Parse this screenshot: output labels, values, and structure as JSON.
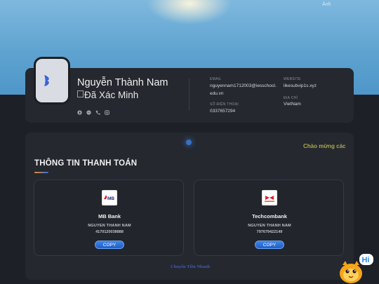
{
  "banner": {
    "image_alt": "Ảnh"
  },
  "profile": {
    "name": "Nguyễn Thành Nam",
    "verified_alt": "Đã Xác Minh",
    "socials": [
      "facebook-icon",
      "messenger-icon",
      "phone-icon",
      "instagram-icon"
    ]
  },
  "contact": {
    "email_label": "EMAIL",
    "email_line1": "nguyennam1712003@iesschool.",
    "email_line2": "edu.vn",
    "phone_label": "SỐ ĐIỆN THOẠI",
    "phone_value": "0337657294",
    "website_label": "WEBSITE",
    "website_value": "likesubvip1s.xyz",
    "address_label": "ĐỊA CHỈ",
    "address_value": "VietNam"
  },
  "greeting": "Chào mừng các",
  "payment": {
    "title": "THÔNG TIN THANH TOÁN",
    "banks": [
      {
        "name": "MB Bank",
        "owner": "NGUYEN THANH NAM",
        "account": "4170120038888",
        "copy_label": "COPY",
        "logo_text": "MB"
      },
      {
        "name": "Techcombank",
        "owner": "NGUYEN THANH NAM",
        "account": "797679422149",
        "copy_label": "COPY",
        "logo_text": "TCB"
      }
    ]
  },
  "footer": {
    "link_text": "Chuyển Tiền Nhanh"
  },
  "mascot": {
    "badge_text": "Hi"
  },
  "colors": {
    "accent": "#2f6fd6",
    "greeting": "#a9a84a",
    "card_bg": "#25282f",
    "page_bg": "#1d2027"
  }
}
